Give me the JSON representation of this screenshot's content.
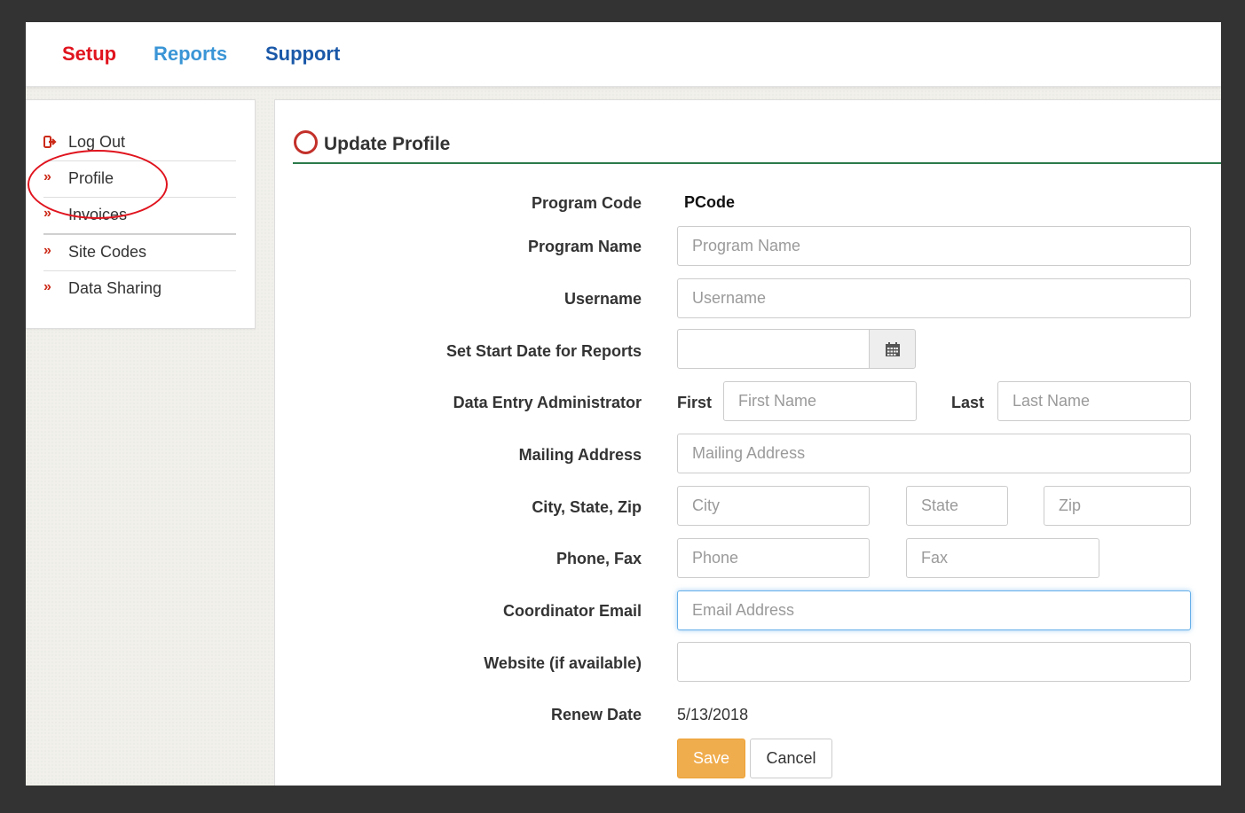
{
  "topnav": {
    "setup": "Setup",
    "reports": "Reports",
    "support": "Support"
  },
  "sidebar": {
    "items": [
      {
        "icon": "logout-icon",
        "label": "Log Out"
      },
      {
        "icon": "double-chevron-icon",
        "label": "Profile"
      },
      {
        "icon": "double-chevron-icon",
        "label": "Invoices"
      },
      {
        "icon": "double-chevron-icon",
        "label": "Site Codes"
      },
      {
        "icon": "double-chevron-icon",
        "label": "Data Sharing"
      }
    ],
    "chevron_glyph": "»"
  },
  "form": {
    "title": "Update Profile",
    "program_code_label": "Program Code",
    "program_code_value": "PCode",
    "program_name_label": "Program Name",
    "program_name_placeholder": "Program Name",
    "username_label": "Username",
    "username_placeholder": "Username",
    "start_date_label": "Set Start Date for Reports",
    "start_date_value": "",
    "admin_label": "Data Entry Administrator",
    "first_label": "First",
    "first_placeholder": "First Name",
    "last_label": "Last",
    "last_placeholder": "Last Name",
    "mailing_label": "Mailing Address",
    "mailing_placeholder": "Mailing Address",
    "city_label": "City, State, Zip",
    "city_placeholder": "City",
    "state_placeholder": "State",
    "zip_placeholder": "Zip",
    "phone_label": "Phone, Fax",
    "phone_placeholder": "Phone",
    "fax_placeholder": "Fax",
    "email_label": "Coordinator Email",
    "email_placeholder": "Email Address",
    "website_label": "Website (if available)",
    "website_value": "",
    "renew_label": "Renew Date",
    "renew_value": "5/13/2018",
    "save_label": "Save",
    "cancel_label": "Cancel"
  },
  "colors": {
    "setup": "#e0141e",
    "reports": "#3a95d6",
    "support": "#1a58a8",
    "accent_rule": "#2c7a4b",
    "save_button": "#f0ad4e",
    "annotation": "#e0141e"
  }
}
